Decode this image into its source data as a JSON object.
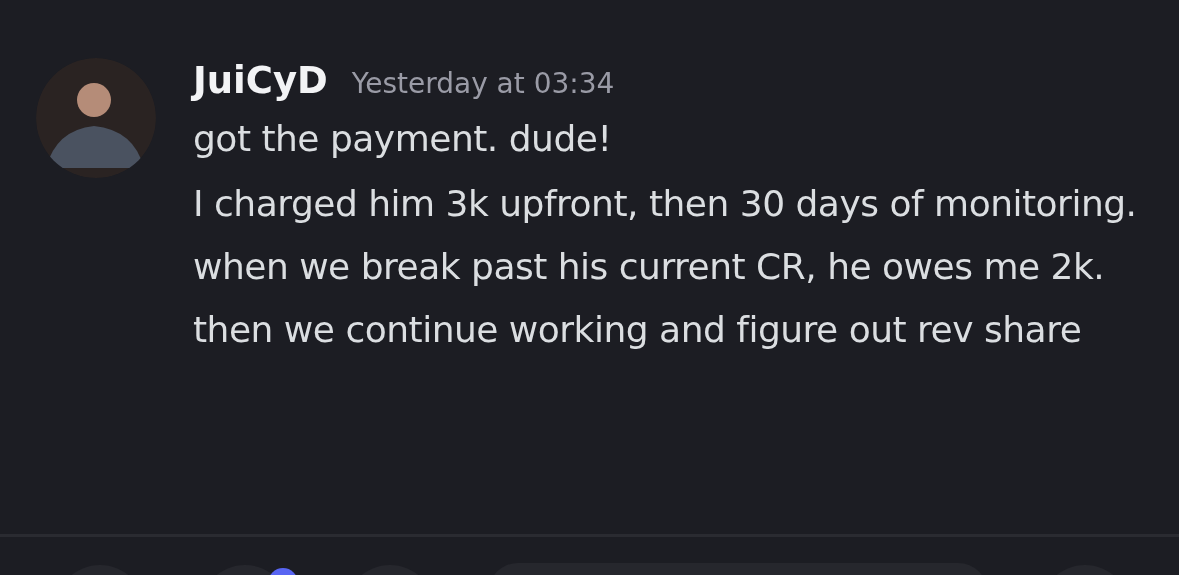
{
  "message": {
    "author": "JuiCyD",
    "timestamp": "Yesterday at 03:34",
    "paragraphs": [
      "got the payment. dude!",
      "I charged him 3k upfront, then 30 days of monitoring. when we break past his current CR, he owes me 2k. then we continue working and figure out rev share"
    ]
  }
}
